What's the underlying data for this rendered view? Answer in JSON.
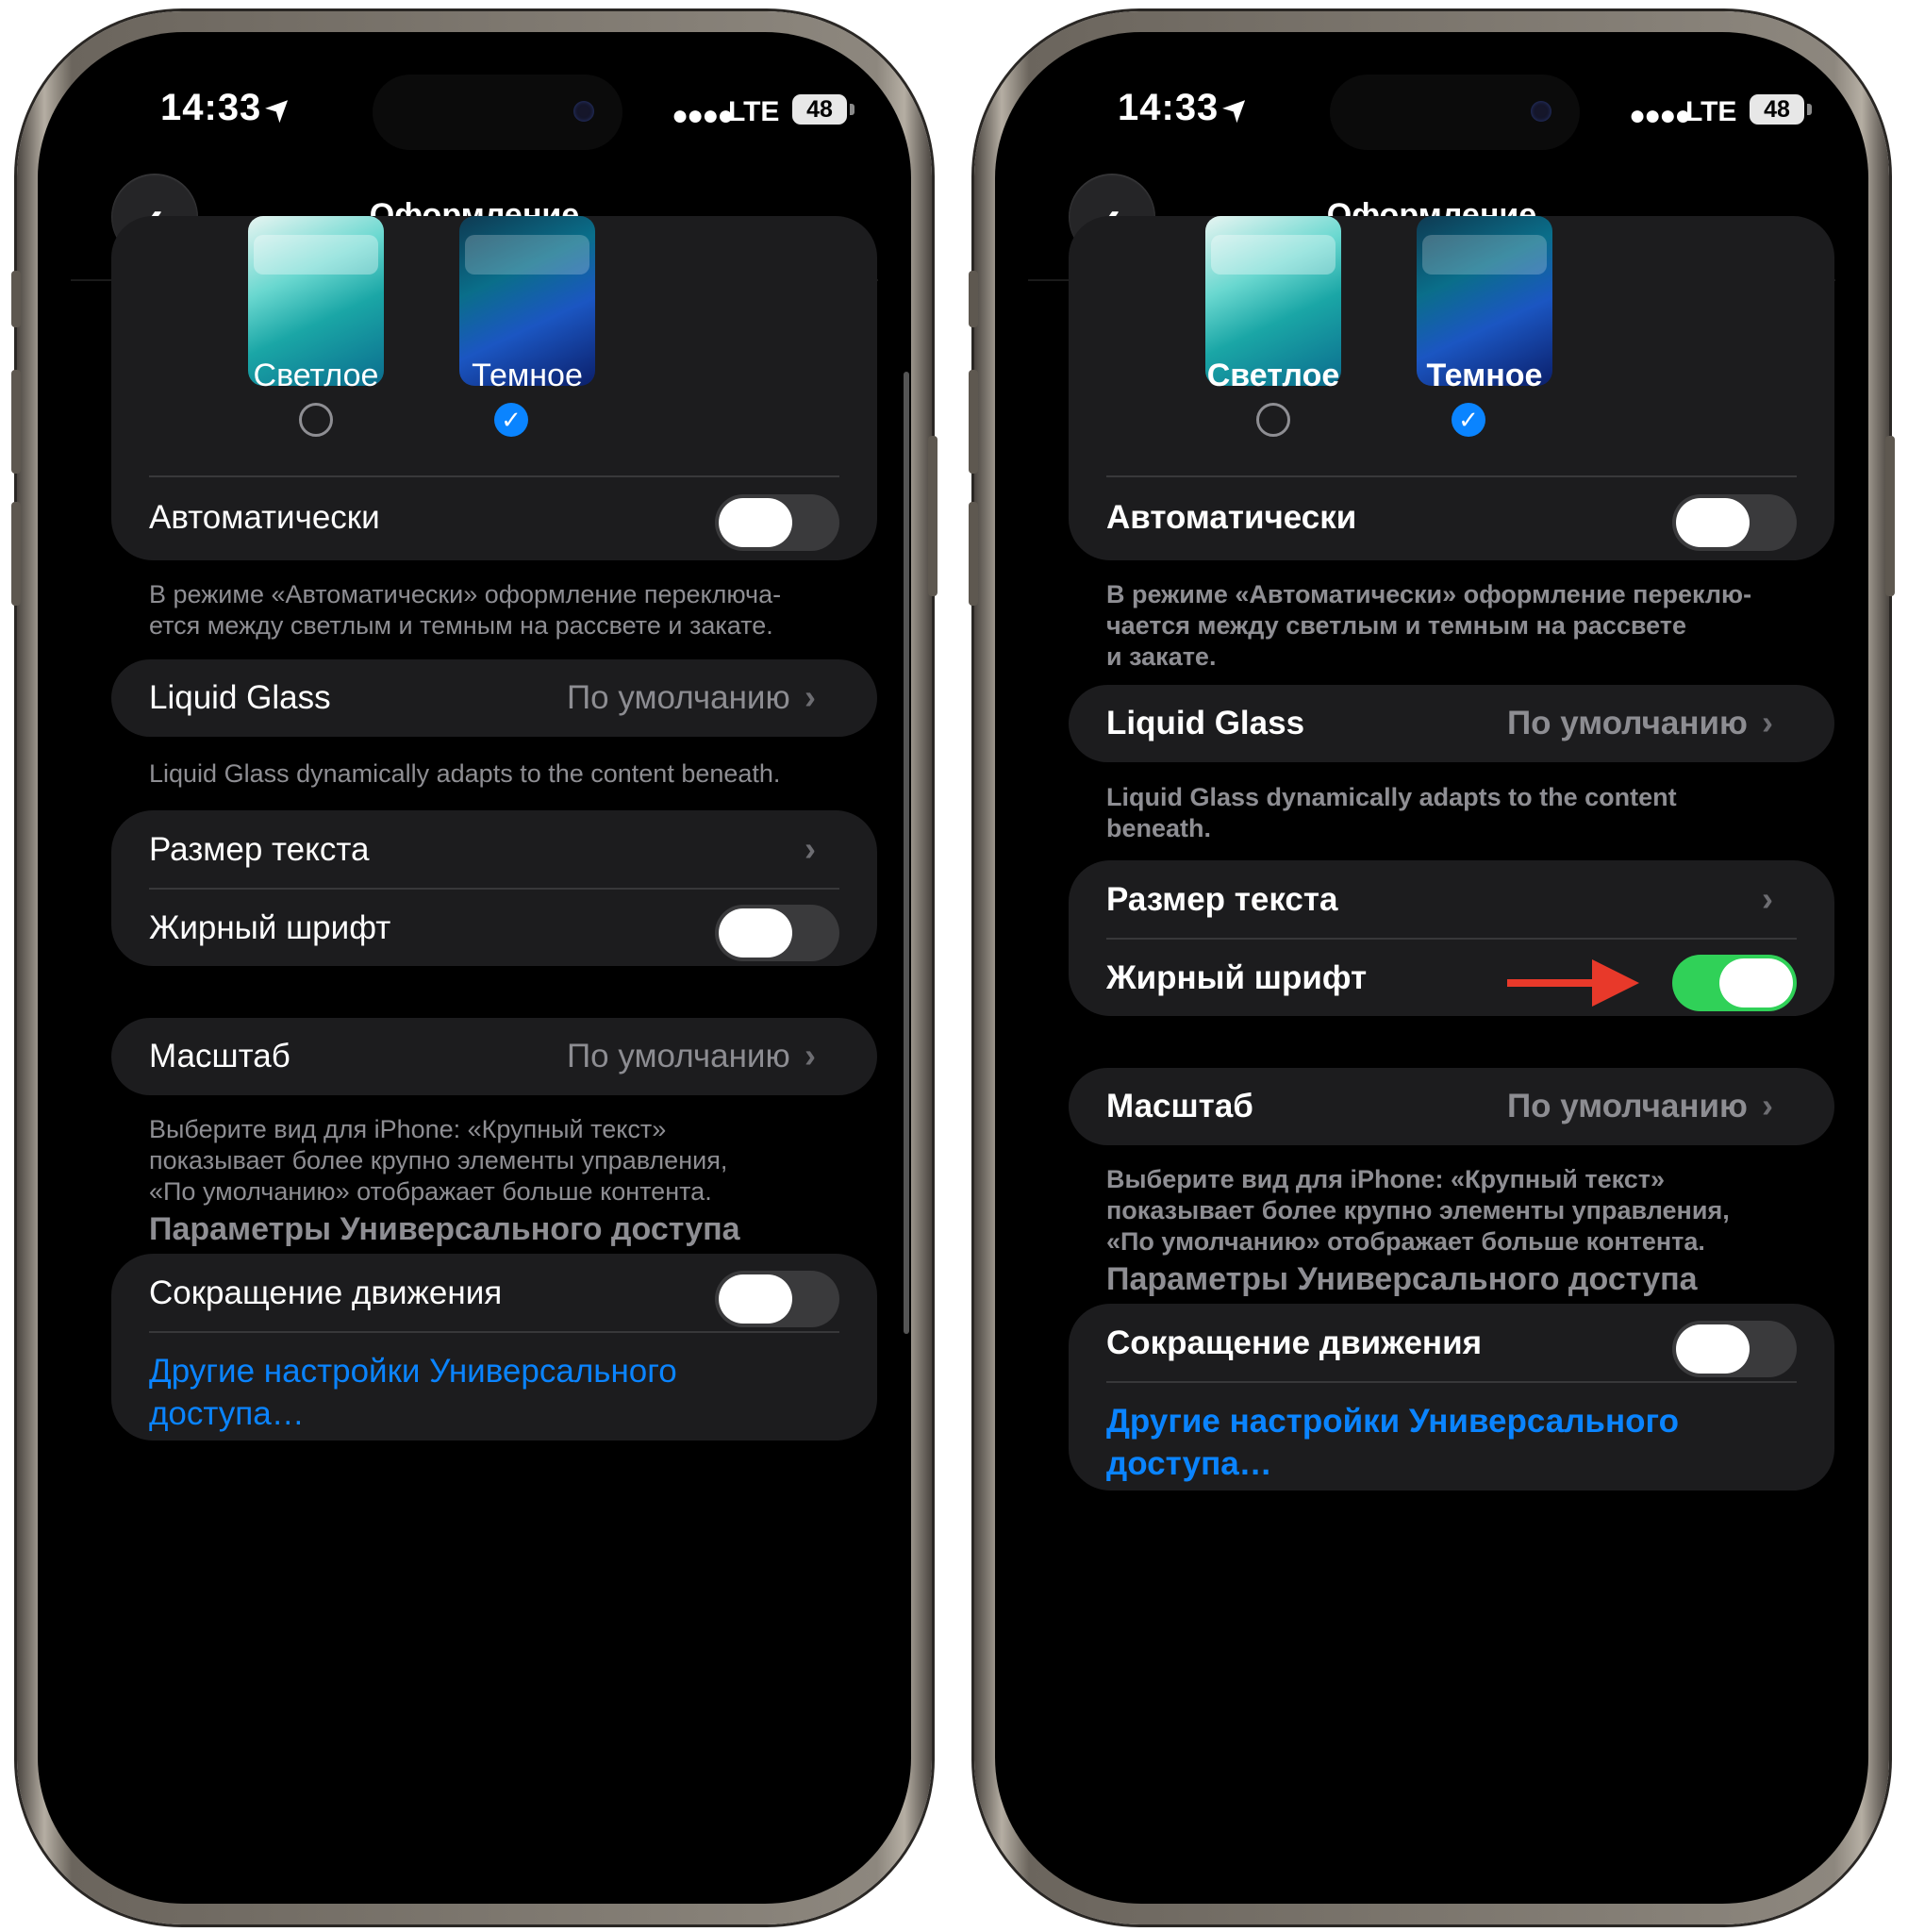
{
  "status": {
    "time": "14:33",
    "network": "LTE",
    "battery": "48"
  },
  "nav": {
    "title": "Оформление"
  },
  "appearance": {
    "light_label": "Светлое",
    "dark_label": "Темное",
    "selected": "dark"
  },
  "auto": {
    "label": "Автоматически",
    "on": false
  },
  "auto_footnote_left": "В режиме «Автоматически» оформление переключа-\nется между светлым и темным на рассвете и закате.",
  "auto_footnote_right": "В режиме «Автоматически» оформление переклю-\nчается между светлым и темным на рассвете\nи закате.",
  "liquid_glass": {
    "label": "Liquid Glass",
    "value": "По умолчанию"
  },
  "liquid_footnote_left": "Liquid Glass dynamically adapts to the content beneath.",
  "liquid_footnote_right": "Liquid Glass dynamically adapts to the content\nbeneath.",
  "text_size": {
    "label": "Размер текста"
  },
  "bold": {
    "label": "Жирный шрифт",
    "left_on": false,
    "right_on": true
  },
  "scale": {
    "label": "Масштаб",
    "value": "По умолчанию"
  },
  "scale_footnote": "Выберите вид для iPhone: «Крупный текст»\nпоказывает более крупно элементы управления,\n«По умолчанию» отображает больше контента.",
  "accessibility": {
    "header": "Параметры Универсального доступа",
    "reduce_motion": "Сокращение движения",
    "reduce_motion_on": false,
    "more_link_left": "Другие настройки Универсального\nдоступа…",
    "more_link_right": "Другие настройки Универсального\nдоступа…"
  },
  "colors": {
    "accent": "#0a84ff",
    "toggle_on": "#30d158",
    "arrow": "#e8392a",
    "cell_bg": "#1c1c1e"
  }
}
